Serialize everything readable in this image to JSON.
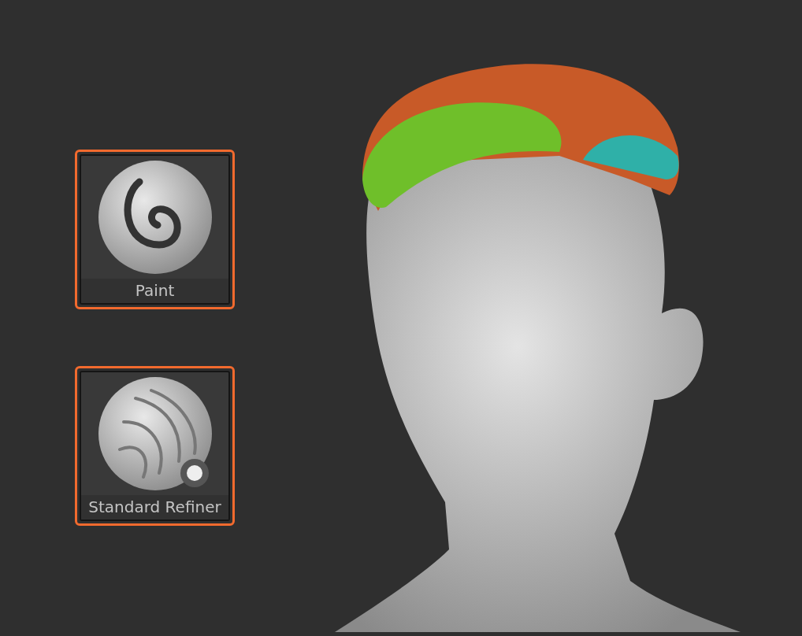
{
  "brushes": [
    {
      "label": "Paint",
      "kind": "spiral",
      "highlighted": true
    },
    {
      "label": "Standard Refiner",
      "kind": "strands",
      "highlighted": true
    }
  ]
}
